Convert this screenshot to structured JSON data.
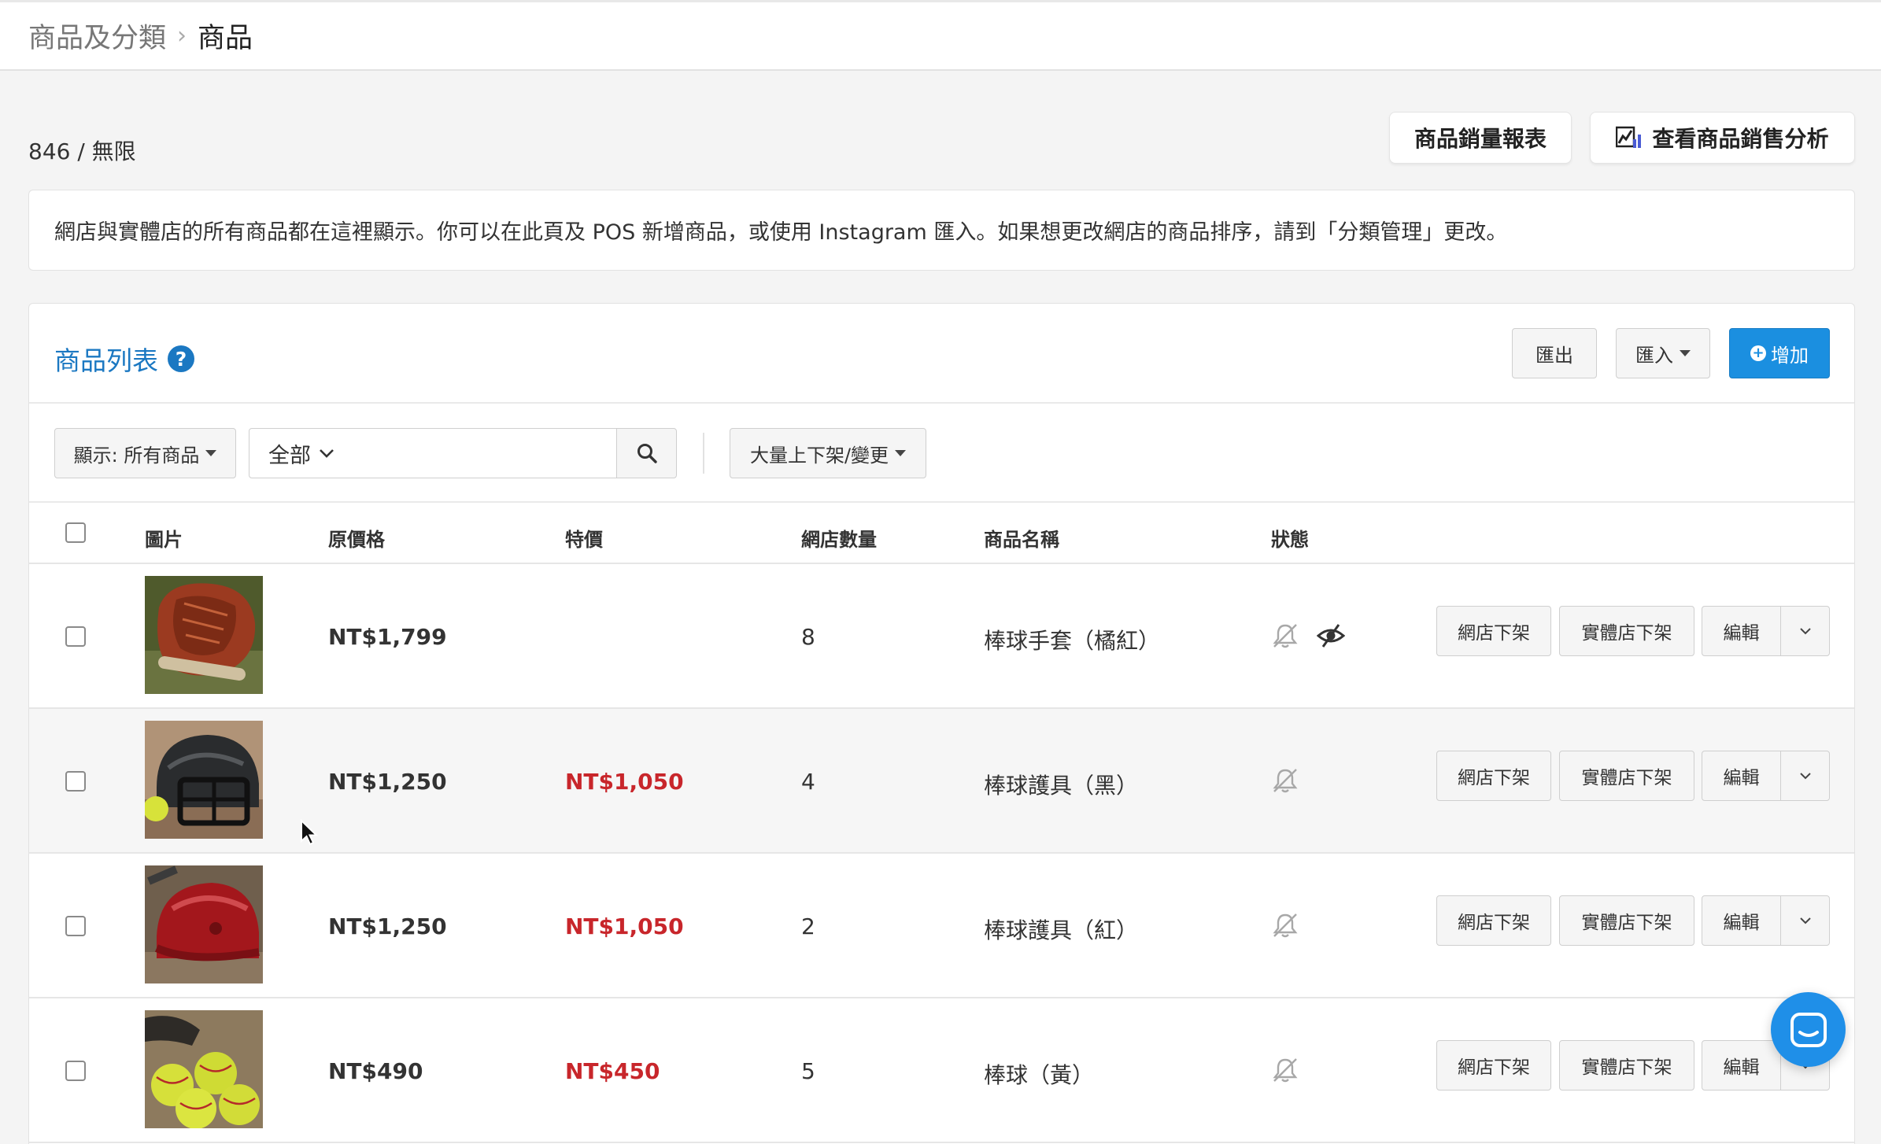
{
  "breadcrumb": {
    "parent": "商品及分類",
    "separator": "›",
    "current": "商品"
  },
  "quota": "846 / 無限",
  "header_buttons": {
    "sales_report": "商品銷量報表",
    "sales_analysis": "查看商品銷售分析"
  },
  "notice": "網店與實體店的所有商品都在這裡顯示。你可以在此頁及 POS 新增商品，或使用 Instagram 匯入。如果想更改網店的商品排序，請到「分類管理」更改。",
  "panel": {
    "title": "商品列表",
    "help": "?",
    "export_label": "匯出",
    "import_label": "匯入",
    "add_label": "增加"
  },
  "filters": {
    "show_label": "顯示: 所有商品",
    "scope_label": "全部",
    "search_placeholder": "",
    "bulk_label": "大量上下架/變更"
  },
  "columns": {
    "image": "圖片",
    "price": "原價格",
    "sale": "特價",
    "qty": "網店數量",
    "name": "商品名稱",
    "status": "狀態"
  },
  "row_actions": {
    "online_off": "網店下架",
    "store_off": "實體店下架",
    "edit": "編輯"
  },
  "products": [
    {
      "price": "NT$1,799",
      "sale": "",
      "qty": "8",
      "name": "棒球手套（橘紅）",
      "status_icons": [
        "bell-off-icon",
        "eye-off-icon"
      ],
      "image": "orange-glove"
    },
    {
      "price": "NT$1,250",
      "sale": "NT$1,050",
      "qty": "4",
      "name": "棒球護具（黑）",
      "status_icons": [
        "bell-off-icon"
      ],
      "image": "black-helmet"
    },
    {
      "price": "NT$1,250",
      "sale": "NT$1,050",
      "qty": "2",
      "name": "棒球護具（紅）",
      "status_icons": [
        "bell-off-icon"
      ],
      "image": "red-helmet"
    },
    {
      "price": "NT$490",
      "sale": "NT$450",
      "qty": "5",
      "name": "棒球（黃）",
      "status_icons": [
        "bell-off-icon"
      ],
      "image": "yellow-balls"
    }
  ],
  "colors": {
    "link_blue": "#1b78c2",
    "primary": "#1b8fe0",
    "sale_red": "#c8262b",
    "background": "#f4f4f4"
  }
}
